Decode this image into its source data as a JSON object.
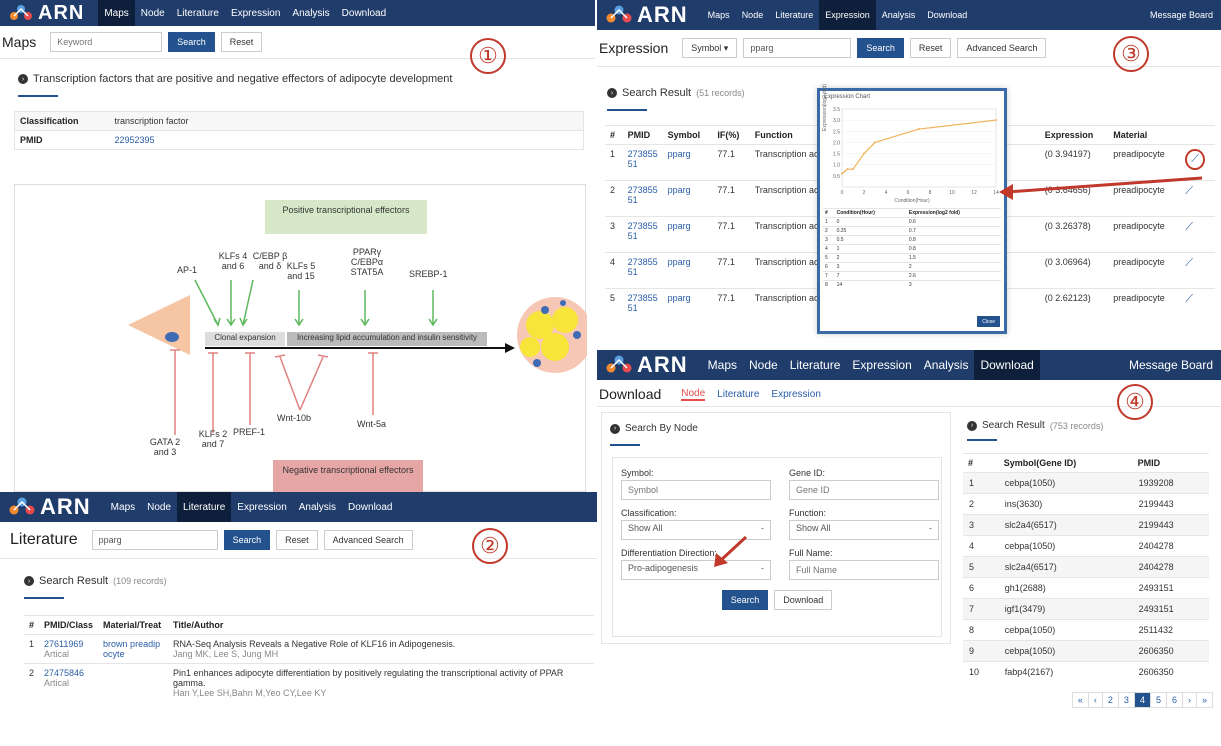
{
  "brand": "ARN",
  "nav": {
    "maps": "Maps",
    "node": "Node",
    "literature": "Literature",
    "expression": "Expression",
    "analysis": "Analysis",
    "download": "Download",
    "message_board": "Message Board"
  },
  "common": {
    "search": "Search",
    "reset": "Reset",
    "advanced_search": "Advanced Search",
    "download_btn": "Download"
  },
  "markers": {
    "one": "①",
    "two": "②",
    "three": "③",
    "four": "④"
  },
  "maps": {
    "title": "Maps",
    "keyword_placeholder": "Keyword",
    "heading": "Transcription factors that are positive and negative effectors of adipocyte development",
    "classification_label": "Classification",
    "classification_value": "transcription factor",
    "pmid_label": "PMID",
    "pmid_value": "22952395",
    "diagram": {
      "positive": "Positive transcriptional effectors",
      "negative": "Negative transcriptional effectors",
      "clonal": "Clonal expansion",
      "lipid": "Increasing lipid accumulation and insulin sensitivity",
      "pos_factors": [
        "AP-1",
        "KLFs 4 and 6",
        "C/EBP β and δ",
        "KLFs 5 and 15",
        "PPARγ C/EBPα STAT5A",
        "SREBP-1"
      ],
      "neg_factors": [
        "GATA 2 and 3",
        "KLFs 2 and 7",
        "PREF-1",
        "Wnt-10b",
        "Wnt-5a"
      ]
    }
  },
  "literature": {
    "title": "Literature",
    "keyword": "pparg",
    "result_label": "Search Result",
    "result_count": "(109 records)",
    "columns": [
      "#",
      "PMID/Class",
      "Material/Treat",
      "Title/Author"
    ],
    "rows": [
      {
        "n": "1",
        "pmid": "27611969",
        "cls": "Artical",
        "material": "brown preadip ocyte",
        "title": "RNA-Seq Analysis Reveals a Negative Role of KLF16 in Adipogenesis.",
        "author": "Jang MK, Lee S, Jung MH"
      },
      {
        "n": "2",
        "pmid": "27475846",
        "cls": "Artical",
        "material": "",
        "title": "Pin1 enhances adipocyte differentiation by positively regulating the transcriptional activity of PPAR gamma.",
        "author": "Han Y,Lee SH,Bahn M,Yeo CY,Lee KY"
      }
    ]
  },
  "expression": {
    "title": "Expression",
    "symbol_select": "Symbol",
    "keyword": "pparg",
    "result_label": "Search Result",
    "result_count": "(51 records)",
    "columns": [
      "#",
      "PMID",
      "Symbol",
      "IF(%)",
      "Function",
      "Expression",
      "Material"
    ],
    "rows": [
      {
        "n": "1",
        "pmid": "273855 51",
        "symbol": "pparg",
        "if": "77.1",
        "func": "Transcription activation o bition",
        "expr": "(0 3.94197)",
        "mat": "preadipocyte"
      },
      {
        "n": "2",
        "pmid": "273855 51",
        "symbol": "pparg",
        "if": "77.1",
        "func": "Transcription activation o bition",
        "expr": "(0 3.64656)",
        "mat": "preadipocyte"
      },
      {
        "n": "3",
        "pmid": "273855 51",
        "symbol": "pparg",
        "if": "77.1",
        "func": "Transcription activation o bition",
        "expr": "(0 3.26378)",
        "mat": "preadipocyte"
      },
      {
        "n": "4",
        "pmid": "273855 51",
        "symbol": "pparg",
        "if": "77.1",
        "func": "Transcription activation o bition",
        "expr": "(0 3.06964)",
        "mat": "preadipocyte"
      },
      {
        "n": "5",
        "pmid": "273855 51",
        "symbol": "pparg",
        "if": "77.1",
        "func": "Transcription activation o bition",
        "expr": "(0 2.62123)",
        "mat": "preadipocyte"
      }
    ],
    "popup": {
      "title": "Expression Chart",
      "xlabel": "Condition(Hour)",
      "ylabel": "Expression(log2 fold)",
      "col1": "Condition(Hour)",
      "col2": "Expression(log2 fold)",
      "close": "Close",
      "table": [
        [
          "1",
          "0",
          "0.6"
        ],
        [
          "2",
          "0.25",
          "0.7"
        ],
        [
          "3",
          "0.5",
          "0.8"
        ],
        [
          "4",
          "1",
          "0.8"
        ],
        [
          "5",
          "2",
          "1.5"
        ],
        [
          "6",
          "3",
          "2"
        ],
        [
          "7",
          "7",
          "2.6"
        ],
        [
          "8",
          "14",
          "3"
        ]
      ]
    }
  },
  "chart_data": {
    "type": "line",
    "title": "Expression Chart",
    "xlabel": "Condition(Hour)",
    "ylabel": "Expression(log2 fold)",
    "x": [
      0,
      0.25,
      0.5,
      1,
      2,
      3,
      7,
      14
    ],
    "values": [
      0.6,
      0.7,
      0.8,
      0.8,
      1.5,
      2,
      2.6,
      3
    ],
    "xlim": [
      0,
      14
    ],
    "ylim": [
      0,
      3.5
    ],
    "xticks": [
      "0",
      "2",
      "4",
      "6",
      "8",
      "10",
      "12",
      "14"
    ],
    "yticks": [
      "0.5",
      "1.0",
      "1.5",
      "2.0",
      "2.5",
      "3.0",
      "3.5"
    ],
    "color": "#f0b45a"
  },
  "download": {
    "title": "Download",
    "tabs": [
      "Node",
      "Literature",
      "Expression"
    ],
    "search_by": "Search By Node",
    "symbol_label": "Symbol:",
    "symbol_ph": "Symbol",
    "geneid_label": "Gene ID:",
    "geneid_ph": "Gene ID",
    "class_label": "Classification:",
    "class_value": "Show All",
    "func_label": "Function:",
    "func_value": "Show All",
    "diff_label": "Differentiation Direction:",
    "diff_value": "Pro-adipogenesis",
    "full_label": "Full Name:",
    "full_ph": "Full Name",
    "result_label": "Search Result",
    "result_count": "(753 records)",
    "columns": [
      "#",
      "Symbol(Gene ID)",
      "PMID"
    ],
    "rows": [
      [
        "1",
        "cebpa(1050)",
        "1939208"
      ],
      [
        "2",
        "ins(3630)",
        "2199443"
      ],
      [
        "3",
        "slc2a4(6517)",
        "2199443"
      ],
      [
        "4",
        "cebpa(1050)",
        "2404278"
      ],
      [
        "5",
        "slc2a4(6517)",
        "2404278"
      ],
      [
        "6",
        "gh1(2688)",
        "2493151"
      ],
      [
        "7",
        "igf1(3479)",
        "2493151"
      ],
      [
        "8",
        "cebpa(1050)",
        "2511432"
      ],
      [
        "9",
        "cebpa(1050)",
        "2606350"
      ],
      [
        "10",
        "fabp4(2167)",
        "2606350"
      ]
    ],
    "pager": [
      "«",
      "‹",
      "2",
      "3",
      "4",
      "5",
      "6",
      "›",
      "»"
    ]
  }
}
